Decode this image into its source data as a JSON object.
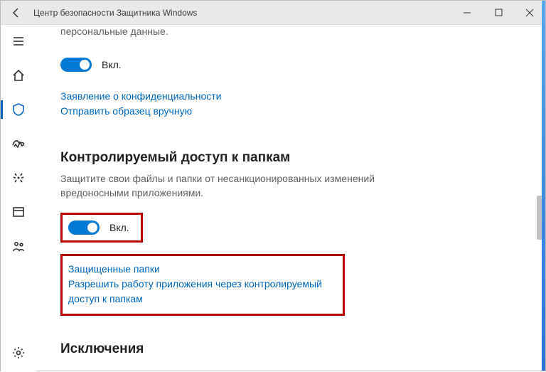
{
  "titlebar": {
    "title": "Центр безопасности Защитника Windows"
  },
  "intro": {
    "line": "персональные данные."
  },
  "cloud_protection": {
    "toggle_state": "Вкл.",
    "privacy_link": "Заявление о конфиденциальности",
    "submit_sample_link": "Отправить образец вручную"
  },
  "folder_access": {
    "title": "Контролируемый доступ к папкам",
    "description": "Защитите свои файлы и папки от несанкционированных изменений вредоносными приложениями.",
    "toggle_state": "Вкл.",
    "protected_folders_link": "Защищенные папки",
    "allow_app_link": "Разрешить работу приложения через контролируемый доступ к папкам"
  },
  "exclusions": {
    "title": "Исключения"
  }
}
